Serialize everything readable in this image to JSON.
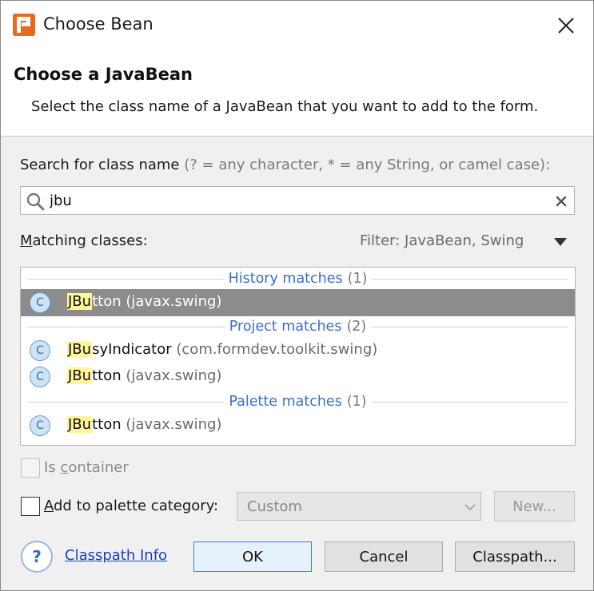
{
  "window": {
    "title": "Choose Bean",
    "app_icon": "app-logo-icon",
    "close_icon": "close-icon"
  },
  "header": {
    "title": "Choose a JavaBean",
    "description": "Select the class name of a JavaBean that you want to add to the form."
  },
  "search": {
    "label": "Search for class name",
    "hint": "(? = any character, * = any String, or camel case):",
    "value": "jbu",
    "search_icon": "search-icon",
    "clear_icon": "clear-icon"
  },
  "matching": {
    "label_first": "M",
    "label_rest": "atching classes:",
    "filter": "Filter: JavaBean, Swing",
    "filter_icon": "dropdown-arrow-icon"
  },
  "groups": [
    {
      "label": "History matches",
      "count": "(1)",
      "items": [
        {
          "match": "JBu",
          "rest": "tton",
          "package": "(javax.swing)",
          "selected": true,
          "icon": "C"
        }
      ]
    },
    {
      "label": "Project matches",
      "count": "(2)",
      "items": [
        {
          "match": "JBu",
          "rest": "syIndicator",
          "package": "(com.formdev.toolkit.swing)",
          "selected": false,
          "icon": "C"
        },
        {
          "match": "JBu",
          "rest": "tton",
          "package": "(javax.swing)",
          "selected": false,
          "icon": "C"
        }
      ]
    },
    {
      "label": "Palette matches",
      "count": "(1)",
      "items": [
        {
          "match": "JBu",
          "rest": "tton",
          "package": "(javax.swing)",
          "selected": false,
          "icon": "C"
        }
      ]
    }
  ],
  "options": {
    "is_container_first": "Is ",
    "is_container_under": "c",
    "is_container_rest": "ontainer",
    "add_palette_first": "A",
    "add_palette_rest": "dd to palette category:",
    "palette_value": "Custom",
    "new_button": "New..."
  },
  "footer": {
    "help_label": "?",
    "classpath_info": "Classpath Info",
    "ok": "OK",
    "cancel": "Cancel",
    "classpath": "Classpath..."
  },
  "colors": {
    "accent": "#3a6fc4",
    "highlight": "#fff59d",
    "selection": "#8c8c8c",
    "app_icon": "#e8691b"
  }
}
